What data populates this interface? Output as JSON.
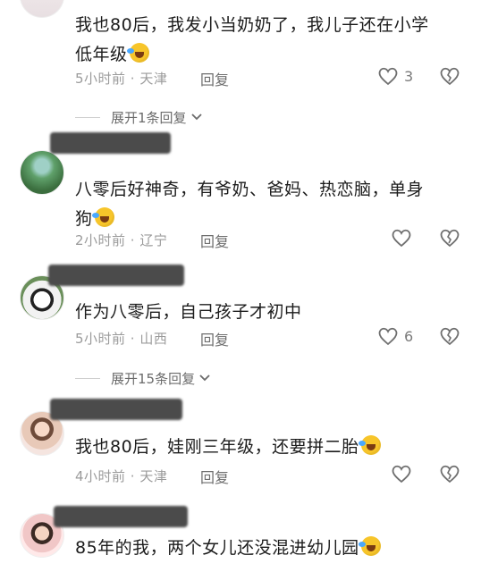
{
  "comments": [
    {
      "text_line1": "我也80后，我发小当奶奶了，我儿子还在小学",
      "text_line2": "低年级",
      "time_location": "5小时前 · 天津",
      "reply_label": "回复",
      "like_count": "3",
      "expand_label": "展开1条回复"
    },
    {
      "text_line1": "八零后好神奇，有爷奶、爸妈、热恋脑，单身",
      "text_line2": "狗",
      "time_location": "2小时前 · 辽宁",
      "reply_label": "回复",
      "like_count": ""
    },
    {
      "text_line1": "作为八零后，自己孩子才初中",
      "time_location": "5小时前 · 山西",
      "reply_label": "回复",
      "like_count": "6",
      "expand_label": "展开15条回复"
    },
    {
      "text_line1": "我也80后，娃刚三年级，还要拼二胎",
      "time_location": "4小时前 · 天津",
      "reply_label": "回复",
      "like_count": ""
    },
    {
      "text_line1": "85年的我，两个女儿还没混进幼儿园"
    }
  ],
  "icons": {
    "like": "heart-outline-icon",
    "dislike": "broken-heart-icon",
    "expand": "chevron-down-icon",
    "emoji": "laughing-crying-emoji"
  }
}
